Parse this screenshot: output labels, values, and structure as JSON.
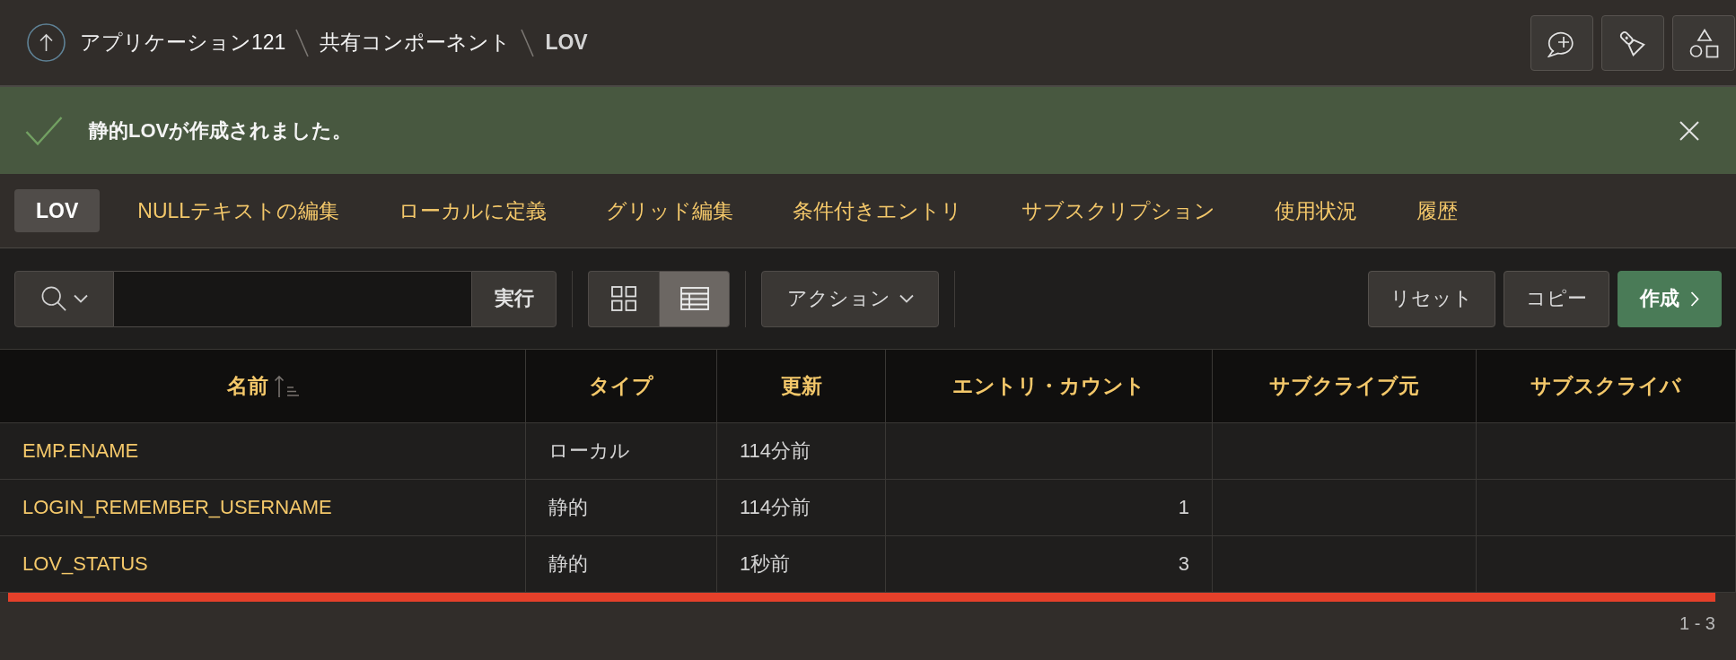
{
  "breadcrumb": [
    {
      "label": "アプリケーション121",
      "current": false
    },
    {
      "label": "共有コンポーネント",
      "current": false
    },
    {
      "label": "LOV",
      "current": true
    }
  ],
  "alert": {
    "message": "静的LOVが作成されました。"
  },
  "tabs": [
    {
      "label": "LOV",
      "selected": true
    },
    {
      "label": "NULLテキストの編集",
      "selected": false
    },
    {
      "label": "ローカルに定義",
      "selected": false
    },
    {
      "label": "グリッド編集",
      "selected": false
    },
    {
      "label": "条件付きエントリ",
      "selected": false
    },
    {
      "label": "サブスクリプション",
      "selected": false
    },
    {
      "label": "使用状況",
      "selected": false
    },
    {
      "label": "履歴",
      "selected": false
    }
  ],
  "toolbar": {
    "go_button": "実行",
    "view_modes": [
      {
        "kind": "icons",
        "selected": false
      },
      {
        "kind": "report",
        "selected": true
      }
    ],
    "actions_menu": "アクション",
    "buttons": [
      {
        "label": "リセット",
        "kind": "default"
      },
      {
        "label": "コピー",
        "kind": "default"
      },
      {
        "label": "作成",
        "kind": "primary"
      }
    ]
  },
  "table": {
    "columns": [
      {
        "label": "名前",
        "kind": "link",
        "sorted": true
      },
      {
        "label": "タイプ",
        "kind": "text",
        "sorted": false
      },
      {
        "label": "更新",
        "kind": "text",
        "sorted": false
      },
      {
        "label": "エントリ・カウント",
        "kind": "number",
        "sorted": false
      },
      {
        "label": "サブクライブ元",
        "kind": "text",
        "sorted": false
      },
      {
        "label": "サブスクライバ",
        "kind": "text",
        "sorted": false
      }
    ],
    "rows": [
      {
        "name": "EMP.ENAME",
        "type": "ローカル",
        "updated": "114分前"
      },
      {
        "name": "LOGIN_REMEMBER_USERNAME",
        "type": "静的",
        "updated": "114分前",
        "entry_count": "1"
      },
      {
        "name": "LOV_STATUS",
        "type": "静的",
        "updated": "1秒前",
        "entry_count": "3"
      }
    ]
  },
  "pagination": {
    "range": "1 - 3"
  }
}
